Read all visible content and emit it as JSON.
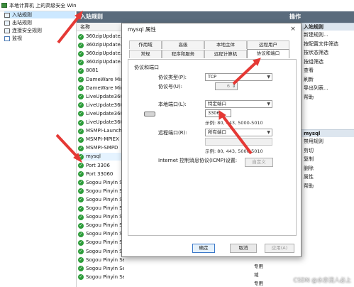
{
  "tree": {
    "root": "本地计算机 上的高级安全 Win",
    "items": [
      "入站规则",
      "出站规则",
      "连接安全规则",
      "监视"
    ]
  },
  "middle": {
    "header": "入站规则",
    "col_name": "名称",
    "rules": [
      {
        "name": "360zipUpdate.e",
        "enabled": true
      },
      {
        "name": "360zipUpdate.e",
        "enabled": true
      },
      {
        "name": "360zipUpdate.e",
        "enabled": true
      },
      {
        "name": "360zipUpdate.e",
        "enabled": true
      },
      {
        "name": "8081",
        "enabled": true
      },
      {
        "name": "DameWare Min",
        "enabled": true
      },
      {
        "name": "DameWare Min",
        "enabled": true
      },
      {
        "name": "LiveUpdate360",
        "enabled": true
      },
      {
        "name": "LiveUpdate360",
        "enabled": true
      },
      {
        "name": "LiveUpdate360",
        "enabled": true
      },
      {
        "name": "LiveUpdate360",
        "enabled": true
      },
      {
        "name": "MSMPI-Launch",
        "enabled": true
      },
      {
        "name": "MSMPI-MPIEX",
        "enabled": true
      },
      {
        "name": "MSMPI-SMPD",
        "enabled": true
      },
      {
        "name": "mysql",
        "enabled": true
      },
      {
        "name": "Port 3306",
        "enabled": true
      },
      {
        "name": "Port 33060",
        "enabled": true
      },
      {
        "name": "Sogou Pinyin S",
        "enabled": true
      },
      {
        "name": "Sogou Pinyin S",
        "enabled": true
      },
      {
        "name": "Sogou Pinyin S",
        "enabled": true
      },
      {
        "name": "Sogou Pinyin S",
        "enabled": true
      },
      {
        "name": "Sogou Pinyin S",
        "enabled": true
      },
      {
        "name": "Sogou Pinyin S",
        "enabled": true
      },
      {
        "name": "Sogou Pinyin S",
        "enabled": true
      },
      {
        "name": "Sogou Pinyin S",
        "enabled": true
      },
      {
        "name": "Sogou Pinyin S",
        "enabled": true
      },
      {
        "name": "Sogou Pinyin Service",
        "enabled": true
      },
      {
        "name": "Sogou Pinyin Service",
        "enabled": true
      },
      {
        "name": "Sogou Pinyin Service",
        "enabled": true
      }
    ],
    "bottom_protocols": [
      "专用",
      "域",
      "专用"
    ]
  },
  "actions": {
    "header": "操作",
    "sections": [
      "入站规则",
      "mysql"
    ],
    "items_top": [
      "新建规则...",
      "按配置文件筛选",
      "按状态筛选",
      "按组筛选",
      "查看",
      "刷新",
      "导出列表...",
      "帮助"
    ],
    "items_bottom": [
      "禁用规则",
      "剪切",
      "复制",
      "删除",
      "属性",
      "帮助"
    ]
  },
  "dialog": {
    "title": "mysql 属性",
    "close": "×",
    "tabs_row1": [
      "作用域",
      "高级",
      "本地主体",
      "远程用户"
    ],
    "tabs_row2": [
      "常规",
      "程序和服务",
      "远程计算机",
      "协议和端口"
    ],
    "group": "协议和端口",
    "protocol_type_label": "协议类型(P):",
    "protocol_type_value": "TCP",
    "protocol_number_label": "协议号(U):",
    "protocol_number_value": "6",
    "local_port_label": "本地端口(L):",
    "local_port_select": "特定端口",
    "local_port_value": "3306",
    "local_port_hint": "示例: 80, 443, 5000-5010",
    "remote_port_label": "远程端口(R):",
    "remote_port_select": "所有端口",
    "remote_port_hint": "示例: 80, 443, 5000-5010",
    "icmp_label": "Internet 控制消息协议(ICMP)设置:",
    "customize": "自定义",
    "ok": "确定",
    "cancel": "取消",
    "apply": "应用(A)"
  },
  "colors": {
    "header_bg": "#5a6b7c",
    "arrow": "#e53935",
    "selection": "#cce8ff"
  },
  "watermark": "CSDN @水亦流人必上"
}
